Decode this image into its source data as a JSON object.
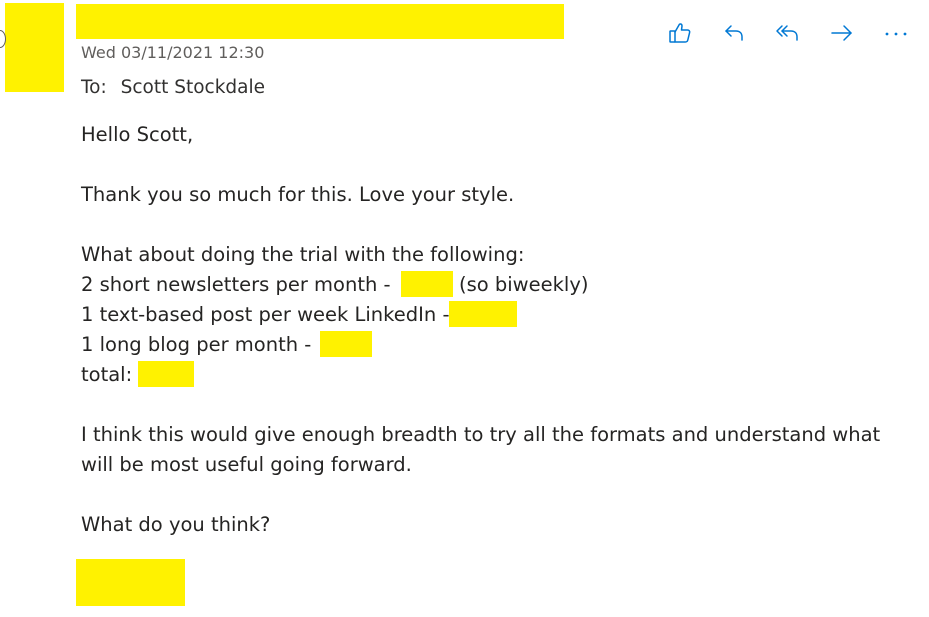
{
  "header": {
    "date": "Wed 03/11/2021 12:30",
    "to_label": "To:",
    "to_name": "Scott Stockdale"
  },
  "actions": {
    "like_icon": "thumbs-up-icon",
    "reply_icon": "reply-arrow-icon",
    "reply_all_icon": "reply-all-arrow-icon",
    "forward_icon": "forward-arrow-icon",
    "more_icon": "more-ellipsis-icon",
    "accent_color": "#0078d4"
  },
  "body": {
    "greeting": "Hello Scott,",
    "thanks": "Thank you so much for this. Love your style.",
    "intro": "What about doing the trial with the following:",
    "item1_pre": "2 short newsletters per month -",
    "item1_post": "(so biweekly)",
    "item2_pre": "1 text-based post per week LinkedIn -",
    "item3_pre": "1 long blog per month -",
    "total_pre": "total:",
    "para_line1": "I think this would give enough breadth to try all the formats and understand what",
    "para_line2": "will be most useful going forward.",
    "question": "What do you think?"
  },
  "redaction_color": "#fff200"
}
